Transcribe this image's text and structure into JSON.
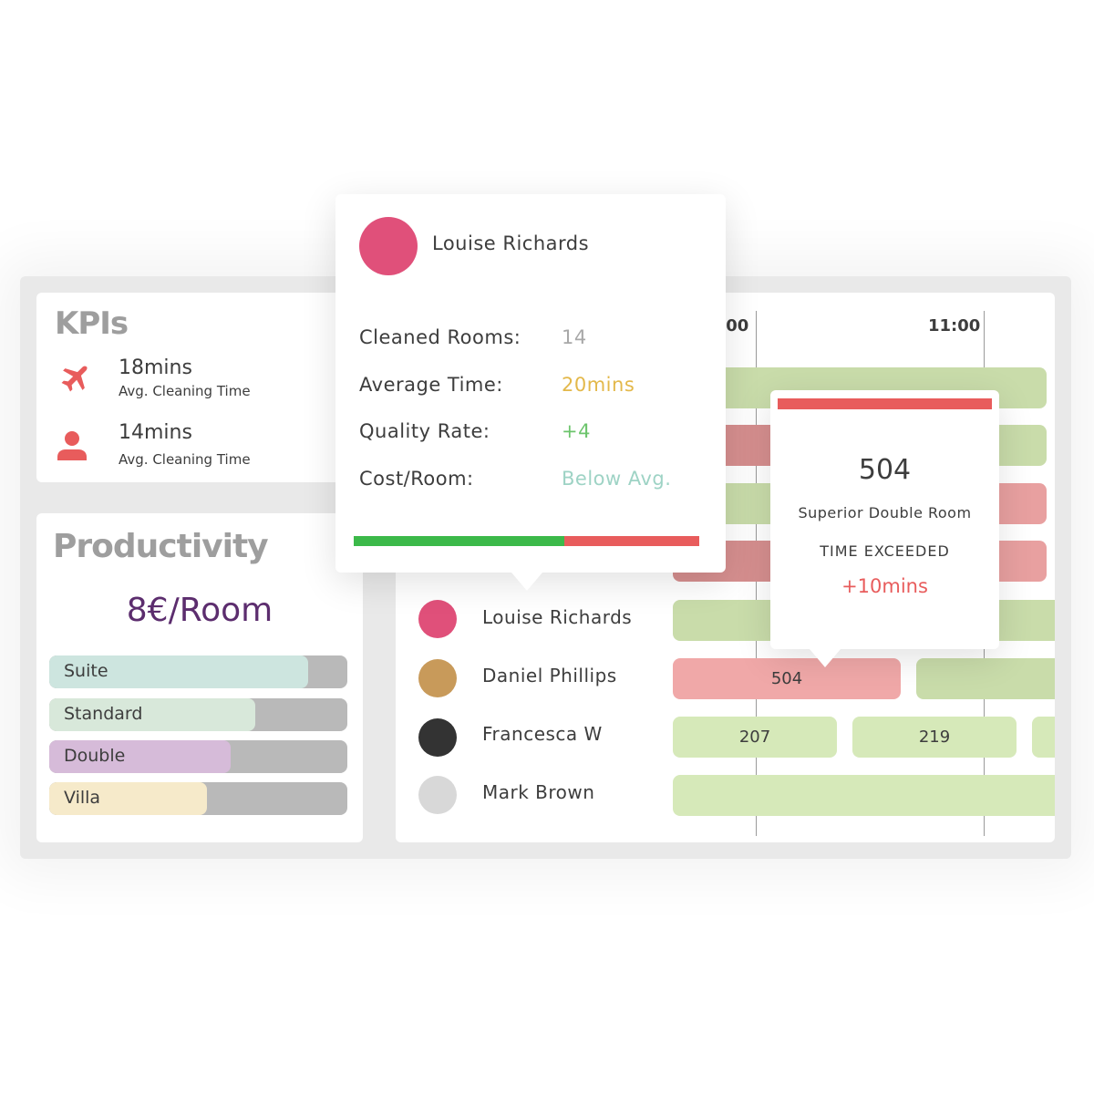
{
  "kpis": {
    "title": "KPIs",
    "items": [
      {
        "icon": "airplane-icon",
        "value": "18mins",
        "label": "Avg. Cleaning Time"
      },
      {
        "icon": "person-icon",
        "value": "14mins",
        "label": "Avg. Cleaning Time"
      }
    ],
    "icon_color": "#e85c5c"
  },
  "productivity": {
    "title": "Productivity",
    "rate": "8€/Room",
    "room_types": [
      {
        "label": "Suite",
        "fill": 0.87,
        "color": "#cde5df"
      },
      {
        "label": "Standard",
        "fill": 0.69,
        "color": "#d8e8da"
      },
      {
        "label": "Double",
        "fill": 0.61,
        "color": "#d6bbd9"
      },
      {
        "label": "Villa",
        "fill": 0.53,
        "color": "#f6eaca"
      }
    ]
  },
  "schedule": {
    "times": [
      "10:00",
      "11:00"
    ],
    "staff": [
      {
        "name": "Louise Richards",
        "avatar_color": "#e0507a"
      },
      {
        "name": "Daniel Phillips",
        "avatar_color": "#c89a5a"
      },
      {
        "name": "Francesca W",
        "avatar_color": "#333333"
      },
      {
        "name": "Mark Brown",
        "avatar_color": "#d8d8d8"
      }
    ],
    "tasks": {
      "daniel": [
        "504"
      ],
      "francesca": [
        "207",
        "219"
      ]
    }
  },
  "staff_popup": {
    "name": "Louise Richards",
    "stats": [
      {
        "label": "Cleaned Rooms:",
        "value": "14",
        "color": "#a8a8a8"
      },
      {
        "label": "Average Time:",
        "value": "20mins",
        "color": "#e3b84a"
      },
      {
        "label": "Quality Rate:",
        "value": "+4",
        "color": "#6cc46c"
      },
      {
        "label": "Cost/Room:",
        "value": "Below Avg.",
        "color": "#9ed3c5"
      }
    ],
    "score_fraction": 0.61,
    "good_color": "#3cb94a",
    "bad_color": "#e85c5c"
  },
  "room_popup": {
    "room": "504",
    "room_type": "Superior Double Room",
    "status": "TIME EXCEEDED",
    "delta": "+10mins",
    "accent": "#e85c5c"
  }
}
